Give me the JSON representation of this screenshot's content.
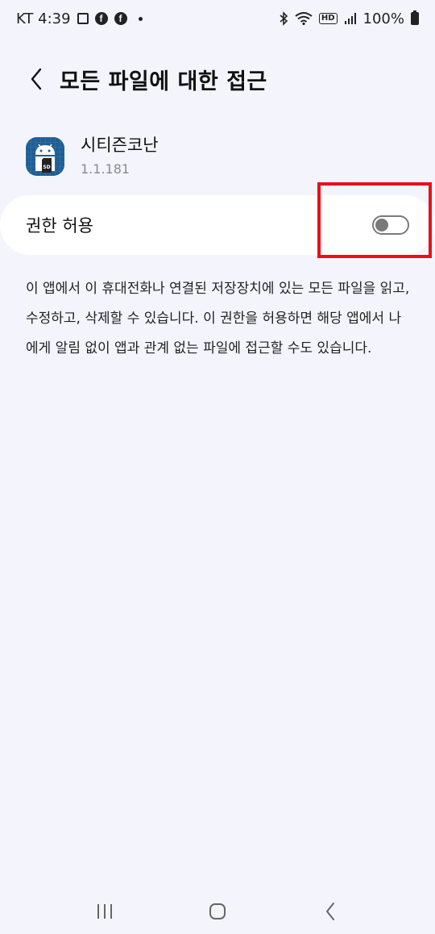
{
  "status_bar": {
    "carrier_time": "KT 4:39",
    "hd": "HD",
    "battery": "100%"
  },
  "header": {
    "title": "모든 파일에 대한 접근"
  },
  "app": {
    "name": "시티즌코난",
    "version": "1.1.181",
    "icon_text": "SD"
  },
  "permission": {
    "label": "권한 허용",
    "toggle_state": "off"
  },
  "description": "이 앱에서 이 휴대전화나 연결된 저장장치에 있는 모든 파일을 읽고, 수정하고, 삭제할 수 있습니다. 이 권한을 허용하면 해당 앱에서 나에게 알림 없이 앱과 관계 없는 파일에 접근할 수도 있습니다.",
  "colors": {
    "background": "#f4f5fc",
    "highlight": "#e8101a",
    "app_icon": "#1f5f93"
  }
}
